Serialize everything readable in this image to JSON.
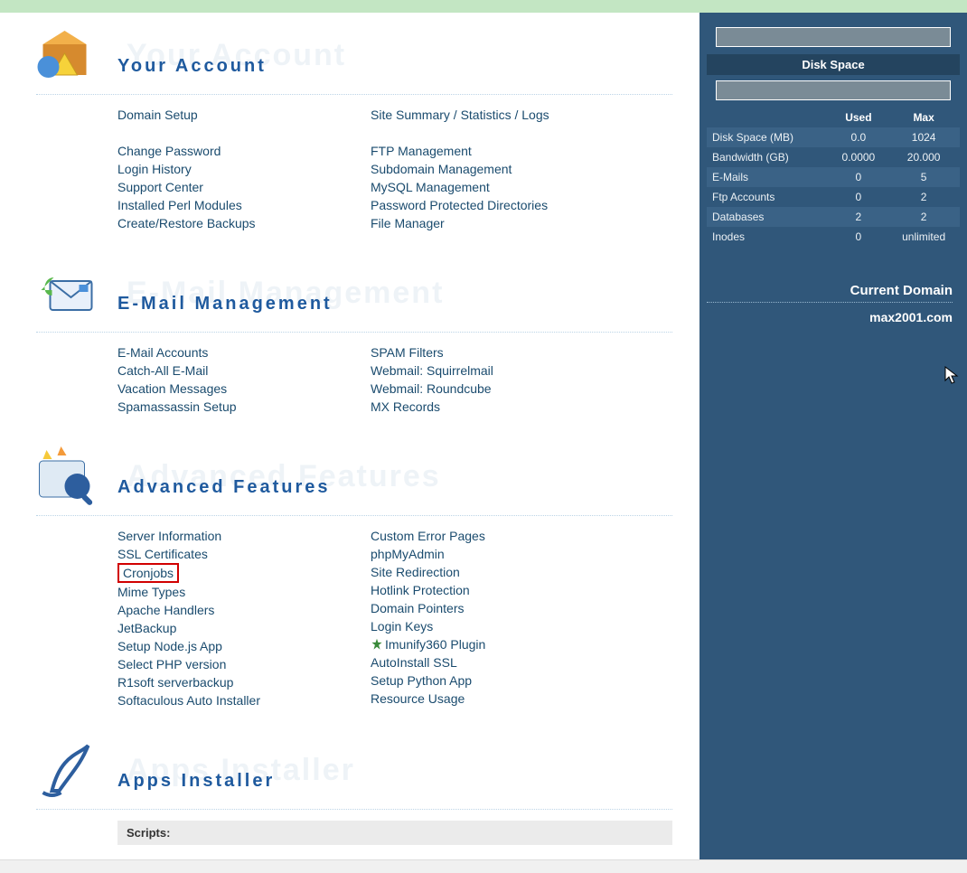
{
  "sections": {
    "account": {
      "shadow": "Your Account",
      "title": "Your Account",
      "left": [
        "Domain Setup",
        "",
        "Change Password",
        "Login History",
        "Support Center",
        "Installed Perl Modules",
        "Create/Restore Backups"
      ],
      "right": [
        "Site Summary / Statistics / Logs",
        "",
        "FTP Management",
        "Subdomain Management",
        "MySQL Management",
        "Password Protected Directories",
        "File Manager"
      ]
    },
    "email": {
      "shadow": "E-Mail Management",
      "title": "E-Mail Management",
      "left": [
        "E-Mail Accounts",
        "Catch-All E-Mail",
        "Vacation Messages",
        "Spamassassin Setup"
      ],
      "right": [
        "SPAM Filters",
        "Webmail: Squirrelmail",
        "Webmail: Roundcube",
        "MX Records"
      ]
    },
    "advanced": {
      "shadow": "Advanced Features",
      "title": "Advanced Features",
      "left": [
        "Server Information",
        "SSL Certificates",
        "Cronjobs",
        "Mime Types",
        "Apache Handlers",
        "JetBackup",
        "Setup Node.js App",
        "Select PHP version",
        "R1soft serverbackup",
        "Softaculous Auto Installer"
      ],
      "right": [
        "Custom Error Pages",
        "phpMyAdmin",
        "Site Redirection",
        "Hotlink Protection",
        "Domain Pointers",
        "Login Keys",
        "Imunify360 Plugin",
        "AutoInstall SSL",
        "Setup Python App",
        "Resource Usage"
      ]
    },
    "apps": {
      "shadow": "Apps Installer",
      "title": "Apps Installer",
      "scripts_label": "Scripts:"
    }
  },
  "highlight_link": "Cronjobs",
  "icon_link": "Imunify360 Plugin",
  "sidebar": {
    "disk_space_label": "Disk Space",
    "headers": {
      "used": "Used",
      "max": "Max"
    },
    "rows": [
      {
        "name": "Disk Space (MB)",
        "used": "0.0",
        "max": "1024",
        "alt": true
      },
      {
        "name": "Bandwidth (GB)",
        "used": "0.0000",
        "max": "20.000",
        "alt": false
      },
      {
        "name": "E-Mails",
        "used": "0",
        "max": "5",
        "alt": true
      },
      {
        "name": "Ftp Accounts",
        "used": "0",
        "max": "2",
        "alt": false
      },
      {
        "name": "Databases",
        "used": "2",
        "max": "2",
        "alt": true
      },
      {
        "name": "Inodes",
        "used": "0",
        "max": "unlimited",
        "alt": false
      }
    ],
    "current_domain_label": "Current Domain",
    "current_domain": "max2001.com"
  }
}
